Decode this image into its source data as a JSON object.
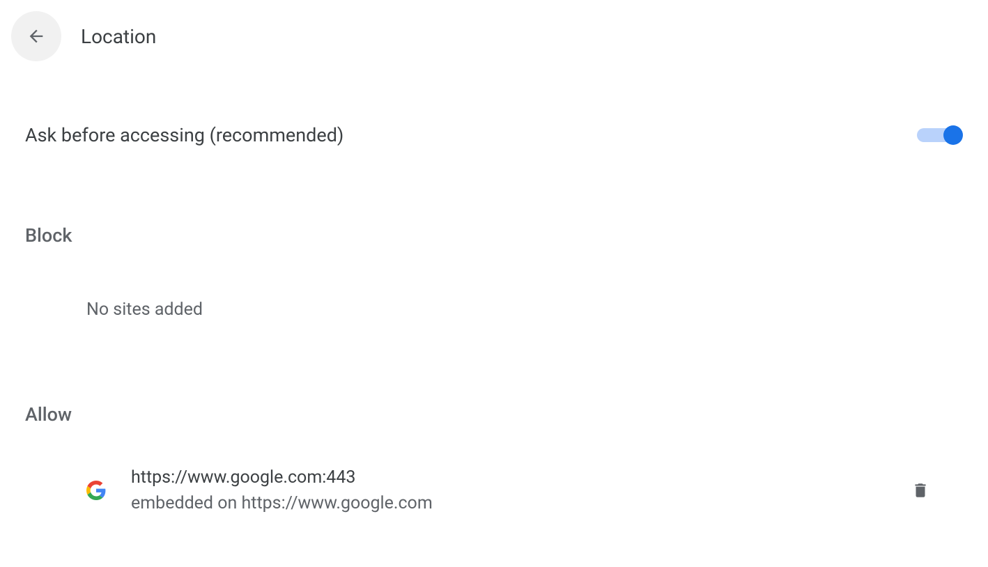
{
  "page": {
    "title": "Location"
  },
  "toggle": {
    "label": "Ask before accessing (recommended)",
    "enabled": true
  },
  "block": {
    "heading": "Block",
    "empty_text": "No sites added"
  },
  "allow": {
    "heading": "Allow",
    "sites": [
      {
        "url": "https://www.google.com:443",
        "embedded": "embedded on https://www.google.com"
      }
    ]
  }
}
